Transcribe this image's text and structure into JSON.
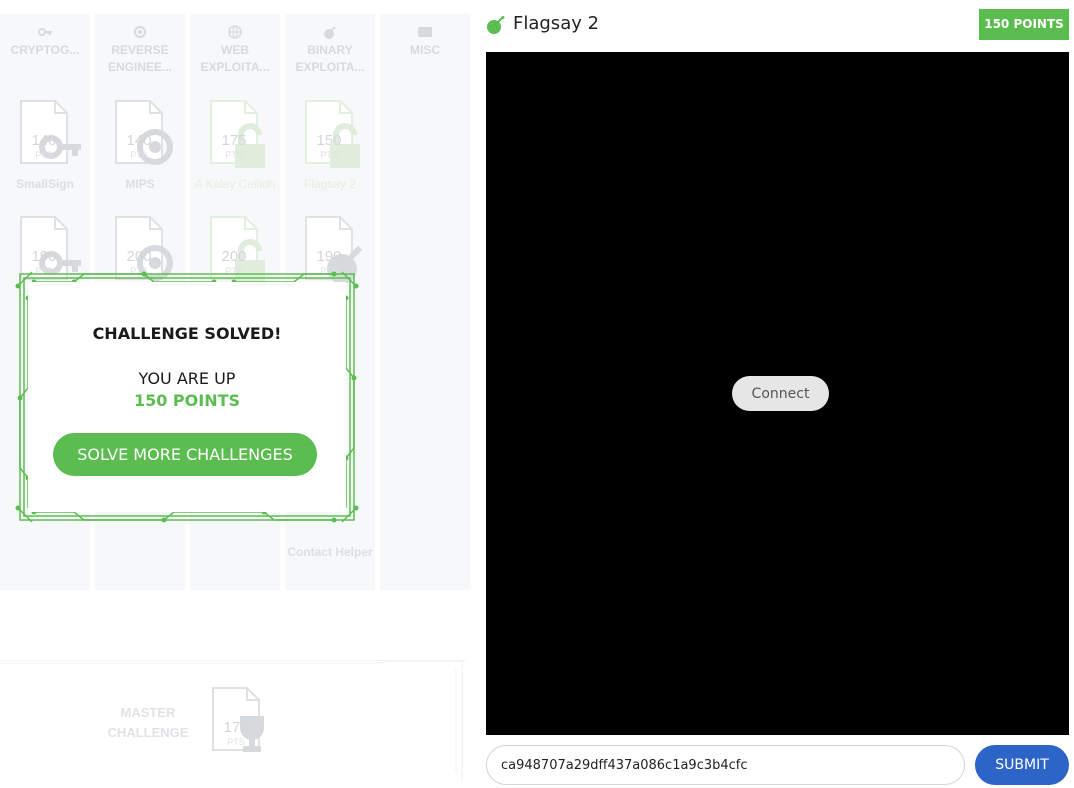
{
  "board": {
    "categories": [
      {
        "label": "CRYPTOG...",
        "icon": "key-icon"
      },
      {
        "label": "REVERSE ENGINEE...",
        "icon": "gear-icon"
      },
      {
        "label": "WEB EXPLOITA...",
        "icon": "globe-icon"
      },
      {
        "label": "BINARY EXPLOITA...",
        "icon": "bomb-icon"
      },
      {
        "label": "MISC",
        "icon": "misc-icon"
      }
    ],
    "cards": [
      {
        "points": "140",
        "unit": "PTS",
        "name": "SmallSign",
        "icon": "key-icon"
      },
      {
        "points": "140",
        "unit": "PTS",
        "name": "MIPS",
        "icon": "gear-icon"
      },
      {
        "points": "175",
        "unit": "PTS",
        "name": "A Kaley Ceilidh",
        "icon": "unlock-icon"
      },
      {
        "points": "150",
        "unit": "PTS",
        "name": "Flagsay 2",
        "icon": "unlock-icon"
      },
      {
        "points": "190",
        "unit": "PTS",
        "name": "",
        "icon": "key-icon"
      },
      {
        "points": "200",
        "unit": "PTS",
        "name": "",
        "icon": "gear-icon"
      },
      {
        "points": "200",
        "unit": "PTS",
        "name": "",
        "icon": "unlock-icon"
      },
      {
        "points": "190",
        "unit": "PTS",
        "name": "",
        "icon": "bomb-icon"
      }
    ],
    "contact_label": "Contact Helper",
    "master": {
      "label": "MASTER CHALLENGE",
      "points": "175",
      "unit": "PTS",
      "icon": "trophy-icon"
    }
  },
  "modal": {
    "title": "CHALLENGE SOLVED!",
    "up_text": "YOU ARE UP",
    "points_text": "150 POINTS",
    "button_label": "SOLVE MORE CHALLENGES",
    "accent": "#5bbd50"
  },
  "challenge": {
    "title": "Flagsay 2",
    "icon": "bomb-icon",
    "points_badge": "150 POINTS",
    "connect_label": "Connect",
    "flag_value": "ca948707a29dff437a086c1a9c3b4cfc",
    "submit_label": "SUBMIT",
    "submit_color": "#2d64c8"
  }
}
